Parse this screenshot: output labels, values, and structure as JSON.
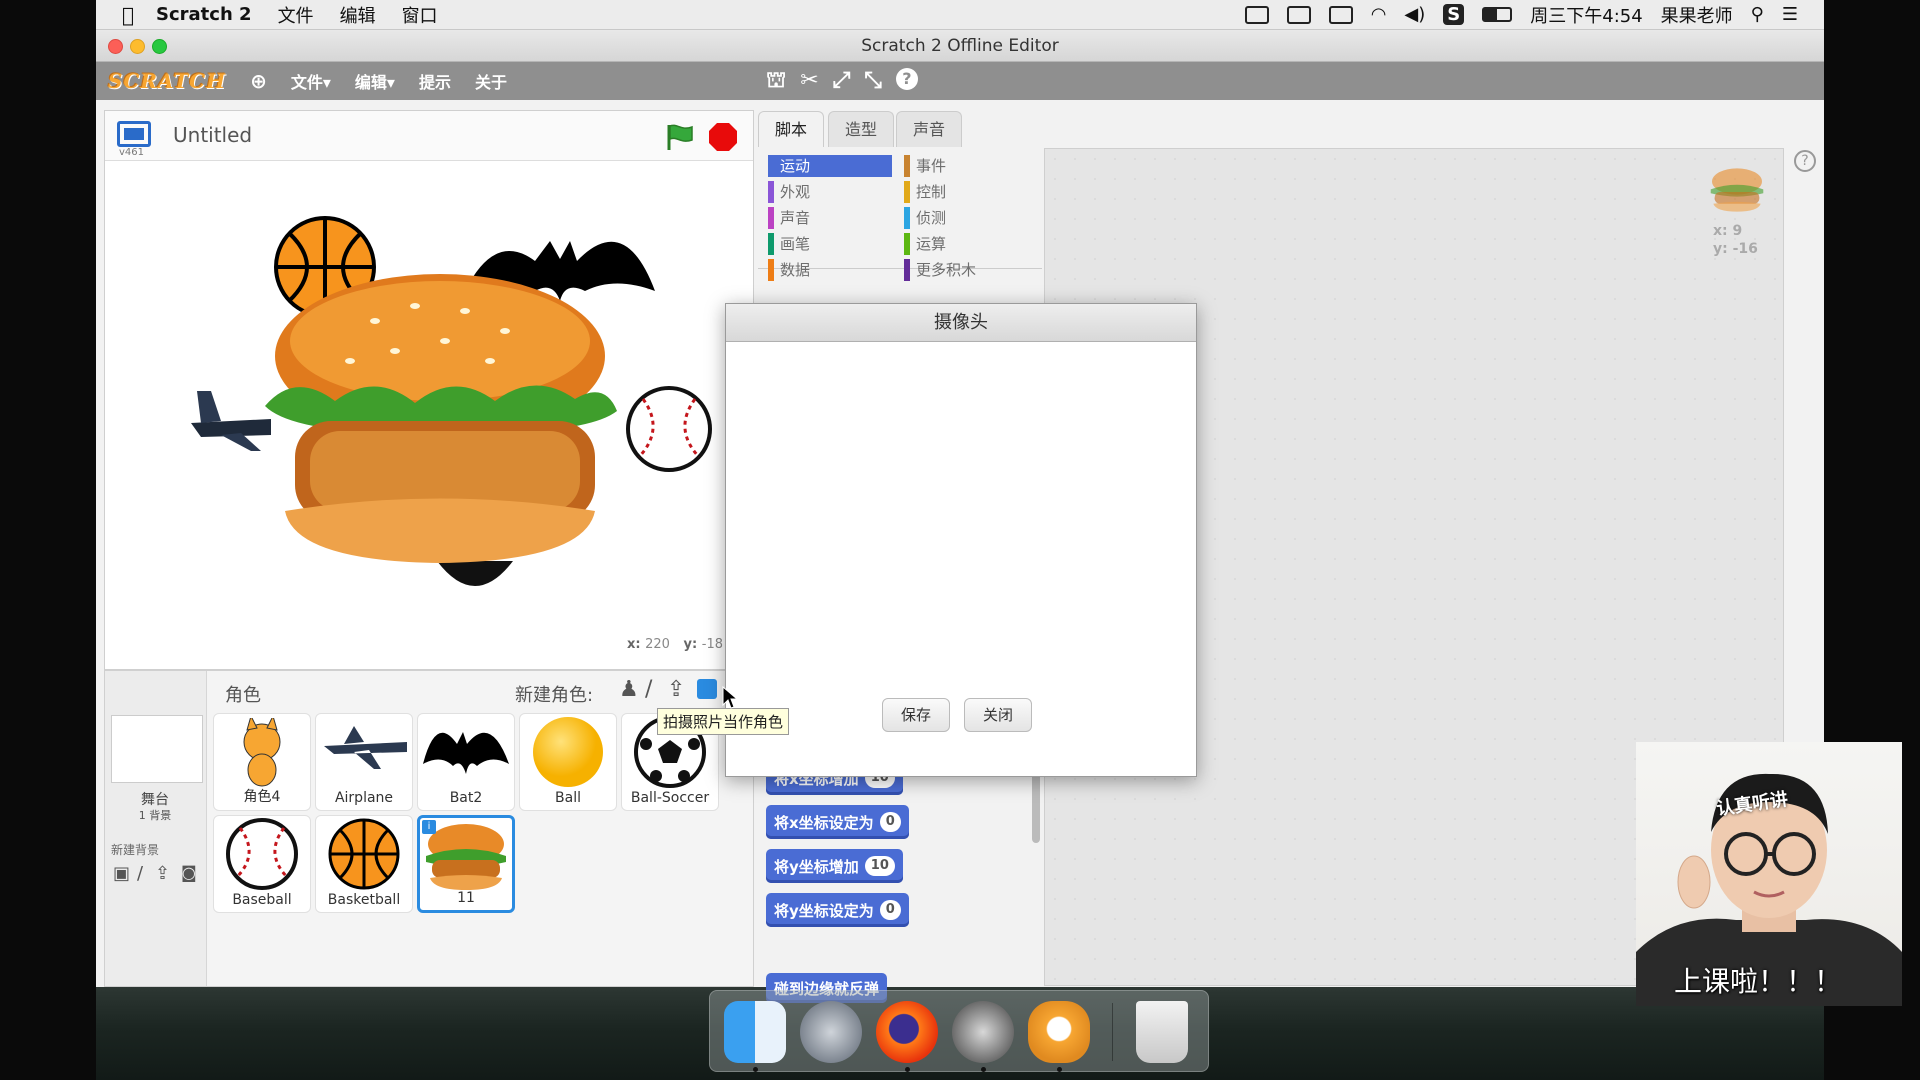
{
  "menubar": {
    "app_name": "Scratch 2",
    "items": [
      "文件",
      "编辑",
      "窗口"
    ],
    "clock": "周三下午4:54",
    "user": "果果老师"
  },
  "window": {
    "title": "Scratch 2 Offline Editor"
  },
  "toolbar": {
    "logo": "SCRATCH",
    "file": "文件▾",
    "edit": "编辑▾",
    "tips": "提示",
    "about": "关于"
  },
  "stage": {
    "project_title": "Untitled",
    "version": "v461",
    "mouse_x_label": "x:",
    "mouse_x": "220",
    "mouse_y_label": "y:",
    "mouse_y": "-18"
  },
  "sprites_pane": {
    "title": "角色",
    "new_sprite_label": "新建角色:",
    "tooltip": "拍摄照片当作角色",
    "stage_label": "舞台",
    "stage_count": "1 背景",
    "new_backdrop_label": "新建背景",
    "sprites": [
      {
        "name": "角色4"
      },
      {
        "name": "Airplane"
      },
      {
        "name": "Bat2"
      },
      {
        "name": "Ball"
      },
      {
        "name": "Ball-Soccer"
      },
      {
        "name": "Baseball"
      },
      {
        "name": "Basketball"
      },
      {
        "name": "11",
        "selected": true
      }
    ]
  },
  "blocks_pane": {
    "tabs": [
      "脚本",
      "造型",
      "声音"
    ],
    "categories_left": [
      {
        "label": "运动",
        "color": "#4a6cd4",
        "active": true
      },
      {
        "label": "外观",
        "color": "#8a55d7"
      },
      {
        "label": "声音",
        "color": "#bb42c3"
      },
      {
        "label": "画笔",
        "color": "#0e9a6c"
      },
      {
        "label": "数据",
        "color": "#ee7d16"
      }
    ],
    "categories_right": [
      {
        "label": "事件",
        "color": "#c88330"
      },
      {
        "label": "控制",
        "color": "#e1a91a"
      },
      {
        "label": "侦测",
        "color": "#2ca5e2"
      },
      {
        "label": "运算",
        "color": "#5cb712"
      },
      {
        "label": "更多积木",
        "color": "#632d99"
      }
    ],
    "blocks": [
      {
        "text": "将x坐标增加",
        "value": "10"
      },
      {
        "text": "将x坐标设定为",
        "value": "0"
      },
      {
        "text": "将y坐标增加",
        "value": "10"
      },
      {
        "text": "将y坐标设定为",
        "value": "0"
      },
      {
        "text": "碰到边缘就反弹",
        "value": ""
      }
    ]
  },
  "script_area": {
    "sprite_x": "x: 9",
    "sprite_y": "y: -16"
  },
  "dialog": {
    "title": "摄像头",
    "save": "保存",
    "close": "关闭"
  },
  "webcam": {
    "caption": "上课啦！！！",
    "sticker": "认真听讲"
  }
}
